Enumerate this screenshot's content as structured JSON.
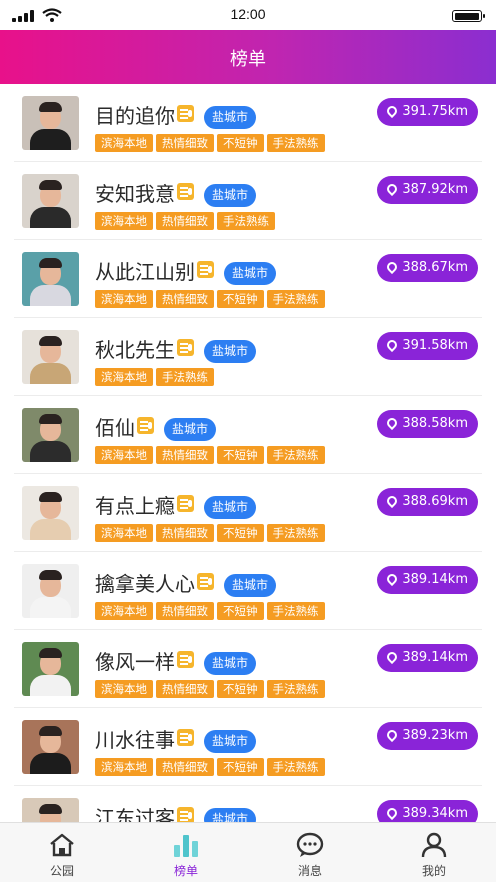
{
  "status_bar": {
    "time": "12:00"
  },
  "header": {
    "title": "榜单"
  },
  "list": [
    {
      "name": "目的追你",
      "city": "盐城市",
      "tags": [
        "滨海本地",
        "热情细致",
        "不短钟",
        "手法熟练"
      ],
      "distance": "391.75km",
      "avatar_bg": "#c9c0b8",
      "shirt": "#1e1e1e"
    },
    {
      "name": "安知我意",
      "city": "盐城市",
      "tags": [
        "滨海本地",
        "热情细致",
        "手法熟练"
      ],
      "distance": "387.92km",
      "avatar_bg": "#d9d3cc",
      "shirt": "#2a2a2a"
    },
    {
      "name": "从此江山别",
      "city": "盐城市",
      "tags": [
        "滨海本地",
        "热情细致",
        "不短钟",
        "手法熟练"
      ],
      "distance": "388.67km",
      "avatar_bg": "#5aa0a8",
      "shirt": "#d8d8e0"
    },
    {
      "name": "秋北先生",
      "city": "盐城市",
      "tags": [
        "滨海本地",
        "手法熟练"
      ],
      "distance": "391.58km",
      "avatar_bg": "#e6e1da",
      "shirt": "#c8a676"
    },
    {
      "name": "佰仙",
      "city": "盐城市",
      "tags": [
        "滨海本地",
        "热情细致",
        "不短钟",
        "手法熟练"
      ],
      "distance": "388.58km",
      "avatar_bg": "#7f8a6a",
      "shirt": "#2c2c2c"
    },
    {
      "name": "有点上瘾",
      "city": "盐城市",
      "tags": [
        "滨海本地",
        "热情细致",
        "不短钟",
        "手法熟练"
      ],
      "distance": "388.69km",
      "avatar_bg": "#ece8e2",
      "shirt": "#e6cdb0"
    },
    {
      "name": "擒拿美人心",
      "city": "盐城市",
      "tags": [
        "滨海本地",
        "热情细致",
        "不短钟",
        "手法熟练"
      ],
      "distance": "389.14km",
      "avatar_bg": "#efefef",
      "shirt": "#f4f4f4"
    },
    {
      "name": "像风一样",
      "city": "盐城市",
      "tags": [
        "滨海本地",
        "热情细致",
        "不短钟",
        "手法熟练"
      ],
      "distance": "389.14km",
      "avatar_bg": "#5f8a52",
      "shirt": "#f2f2f2"
    },
    {
      "name": "川水往事",
      "city": "盐城市",
      "tags": [
        "滨海本地",
        "热情细致",
        "不短钟",
        "手法熟练"
      ],
      "distance": "389.23km",
      "avatar_bg": "#a8745a",
      "shirt": "#1c1c1c"
    },
    {
      "name": "江东过客",
      "city": "盐城市",
      "tags": [],
      "distance": "389.34km",
      "avatar_bg": "#d8c9b8",
      "shirt": "#7a6a5a"
    }
  ],
  "tabbar": [
    {
      "label": "公园",
      "icon": "home-icon",
      "active": false
    },
    {
      "label": "榜单",
      "icon": "ranking-icon",
      "active": true
    },
    {
      "label": "消息",
      "icon": "message-icon",
      "active": false
    },
    {
      "label": "我的",
      "icon": "profile-icon",
      "active": false
    }
  ],
  "colors": {
    "header_start": "#e8118a",
    "header_end": "#8b2ed0",
    "distance_badge": "#8a24d8",
    "city_badge": "#2c7ef2",
    "tag": "#f59c22",
    "vip": "#f6b52c"
  }
}
